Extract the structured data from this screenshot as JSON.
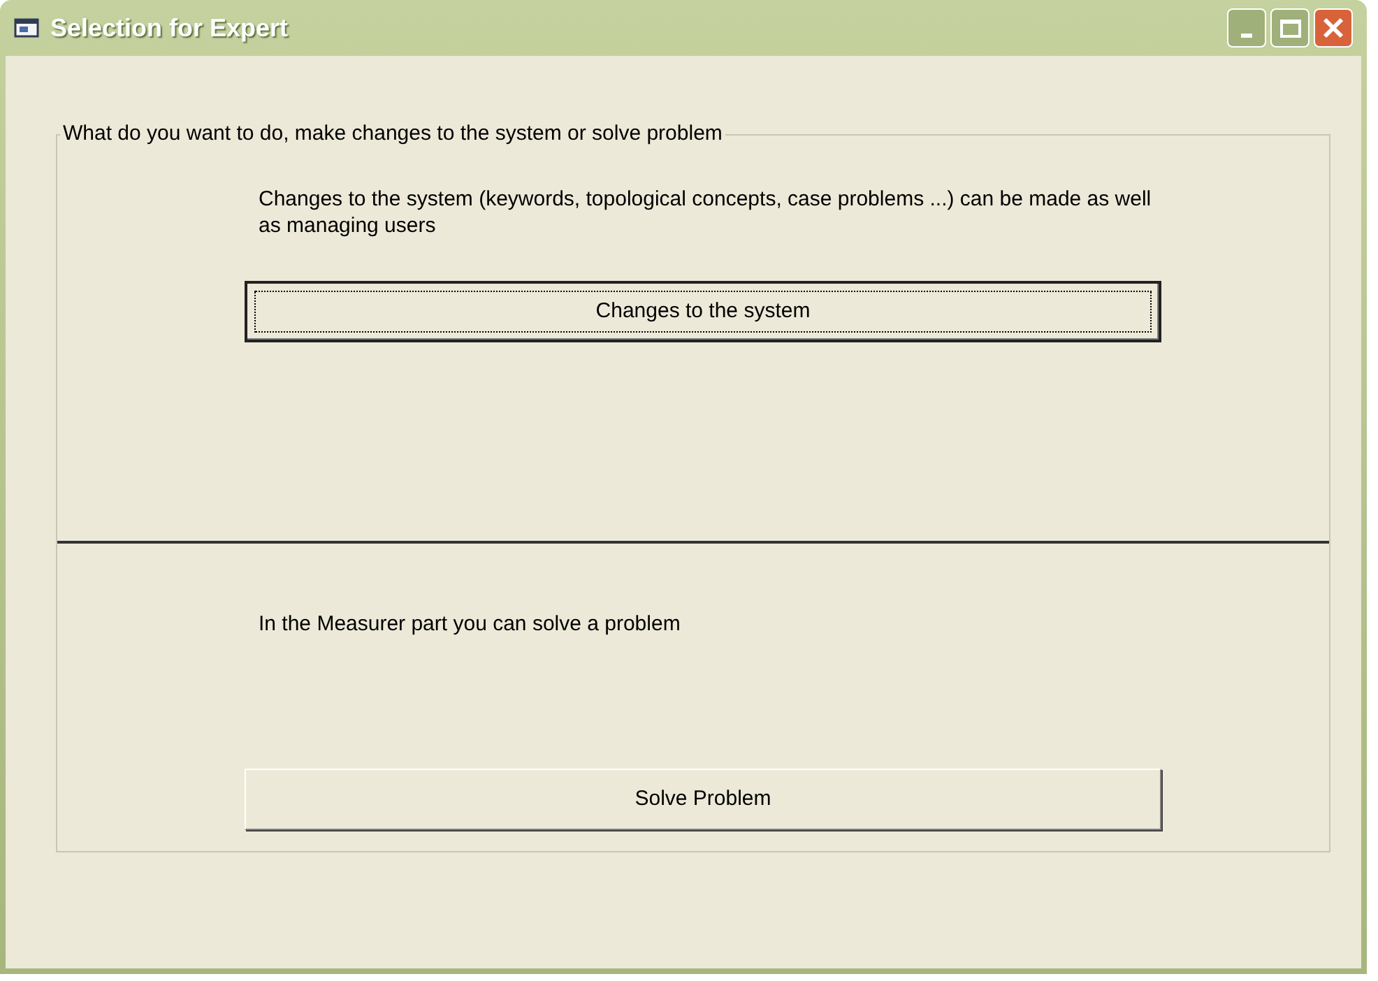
{
  "window": {
    "title": "Selection for Expert"
  },
  "group": {
    "legend": "What do you want to do, make changes to the system or solve problem",
    "sections": [
      {
        "text": "Changes to the system (keywords, topological concepts, case problems ...) can be made as well as managing users",
        "button": {
          "label": "Changes to the system",
          "focused": true
        }
      },
      {
        "text": "In the Measurer part you can solve a problem",
        "button": {
          "label": "Solve Problem",
          "focused": false
        }
      }
    ]
  }
}
